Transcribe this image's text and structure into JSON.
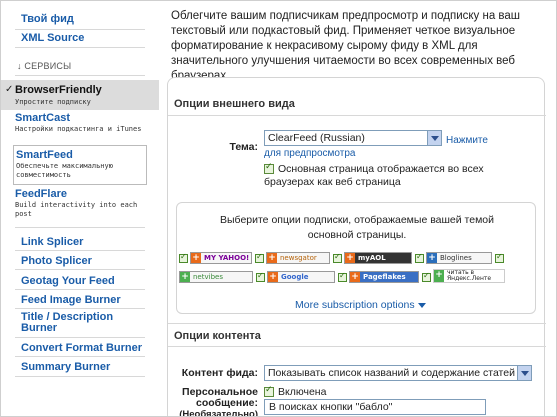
{
  "sidebar": {
    "top_links": [
      "Твой фид",
      "XML Source"
    ],
    "section_title": "↓ СЕРВИСЫ",
    "active_item": {
      "check": "✓",
      "title": "BrowserFriendly",
      "subtitle": "Упростите подписку"
    },
    "items": [
      {
        "title": "SmartCast",
        "subtitle": "Настройки подкастинга и iTunes"
      },
      {
        "title": "SmartFeed",
        "subtitle": "Обеспечьте максимальную совместимость"
      },
      {
        "title": "FeedFlare",
        "subtitle": "Build interactivity into each post"
      }
    ],
    "links": [
      "Link Splicer",
      "Photo Splicer",
      "Geotag Your Feed",
      "Feed Image Burner",
      "Title / Description Burner",
      "Convert Format Burner",
      "Summary Burner"
    ]
  },
  "main": {
    "intro": "Облегчите вашим подписчикам предпросмотр и подписку на ваш текстовый или подкастовый фид. Применяет четкое визуальное форматирование к некрасивому сырому фиду в XML для значительного улучшения читаемости во всех современных веб браузерах.",
    "appearance": {
      "heading": "Опции внешнего вида",
      "theme_label": "Тема:",
      "theme_value": "ClearFeed (Russian)",
      "preview_link": "Нажмите для предпросмотра",
      "main_page_checkbox": "Основная страница отображается во всех браузерах как веб страница"
    },
    "subscribe": {
      "text": "Выберите опции подписки, отображаемые вашей темой основной страницы.",
      "badges": [
        "MY YAHOO!",
        "newsgator",
        "myAOL",
        "Bloglines",
        "netvibes",
        "Google",
        "Pageflakes",
        "читать в Яндекс.Ленте"
      ],
      "more_link": "More subscription options"
    },
    "content": {
      "heading": "Опции контента",
      "feed_content_label": "Контент фида:",
      "feed_content_value": "Показывать список названий и содержание статей",
      "personal_label": "Персональное сообщение:",
      "personal_label_extra": "(Необязательно)",
      "enabled_checkbox": "Включена",
      "message_value": "В поисках кнопки \"бабло\""
    }
  },
  "colors": {
    "link": "#1a5ca8",
    "active_bg": "#dcdcdc",
    "feedburner_orange": "#e96a1a"
  }
}
